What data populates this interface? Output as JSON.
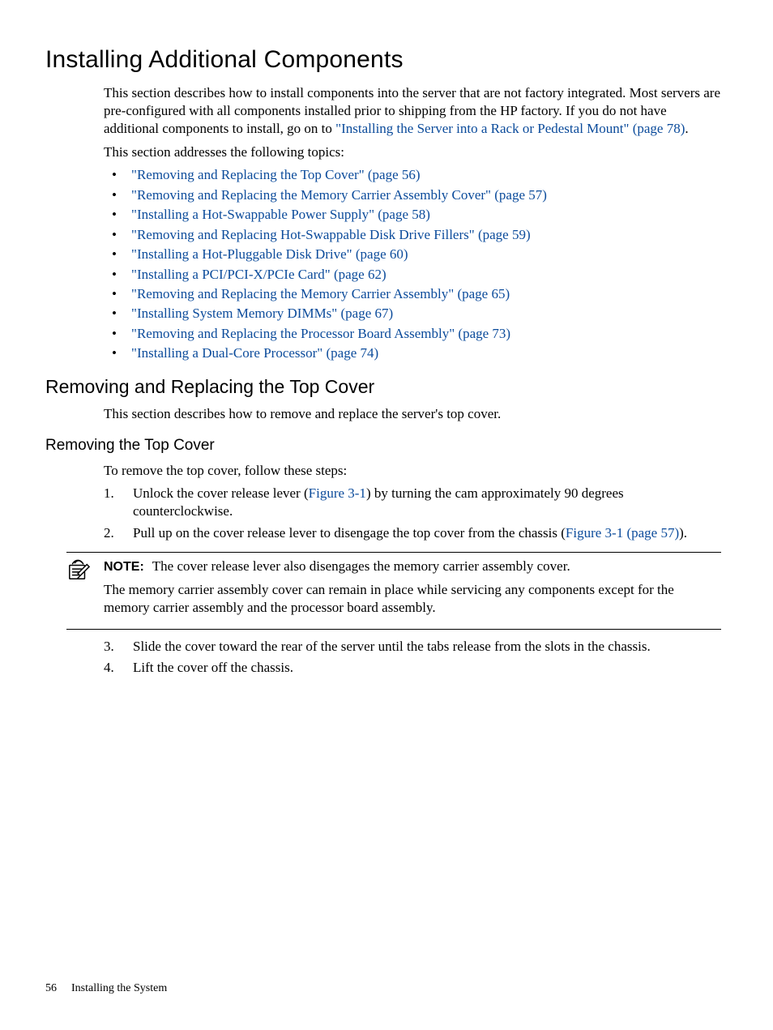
{
  "heading": "Installing Additional Components",
  "intro_part1": "This section describes how to install components into the server that are not factory integrated. Most servers are pre-configured with all components installed prior to shipping from the HP factory. If you do not have additional components to install, go on to ",
  "intro_link": "\"Installing the Server into a Rack or Pedestal Mount\" (page 78)",
  "intro_part2": ".",
  "topics_lead": "This section addresses the following topics:",
  "topics": [
    "\"Removing and Replacing the Top Cover\" (page 56)",
    "\"Removing and Replacing the Memory Carrier Assembly Cover\" (page 57)",
    "\"Installing a Hot-Swappable Power Supply\" (page 58)",
    "\"Removing and Replacing Hot-Swappable Disk Drive Fillers\" (page 59)",
    "\"Installing a Hot-Pluggable Disk Drive\" (page 60)",
    "\"Installing a PCI/PCI-X/PCIe Card\" (page 62)",
    "\"Removing and Replacing the Memory Carrier Assembly\" (page 65)",
    "\"Installing System Memory DIMMs\" (page 67)",
    "\"Removing and Replacing the Processor Board Assembly\" (page 73)",
    "\"Installing a Dual-Core Processor\" (page 74)"
  ],
  "sub_heading": "Removing and Replacing the Top Cover",
  "sub_intro": "This section describes how to remove and replace the server's top cover.",
  "subsub_heading": "Removing the Top Cover",
  "steps_lead": "To remove the top cover, follow these steps:",
  "step1_a": "Unlock the cover release lever (",
  "step1_link": "Figure 3-1",
  "step1_b": ") by turning the cam approximately 90 degrees counterclockwise.",
  "step2_a": "Pull up on the cover release lever to disengage the top cover from the chassis (",
  "step2_link": "Figure 3-1 (page 57)",
  "step2_b": ").",
  "note_label": "NOTE:",
  "note_line1": "The cover release lever also disengages the memory carrier assembly cover.",
  "note_line2": "The memory carrier assembly cover can remain in place while servicing any components except for the memory carrier assembly and the processor board assembly.",
  "step3": "Slide the cover toward the rear of the server until the tabs release from the slots in the chassis.",
  "step4": "Lift the cover off the chassis.",
  "footer_page": "56",
  "footer_text": "Installing the System"
}
